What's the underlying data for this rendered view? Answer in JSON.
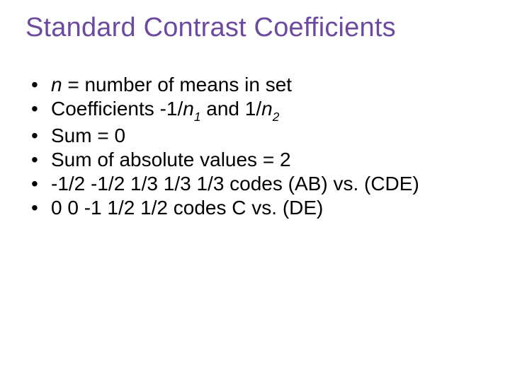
{
  "title": "Standard  Contrast Coefficients",
  "bullets": {
    "b1a": "n",
    "b1b": " = number of means in set",
    "b2a": "Coefficients -1/",
    "b2n1": "n",
    "b2s1": "1",
    "b2b": "  and 1/",
    "b2n2": "n",
    "b2s2": "2",
    "b3": "Sum = 0",
    "b4": "Sum of absolute values = 2",
    "b5": "-1/2 -1/2 1/3 1/3 1/3 codes (AB) vs. (CDE)",
    "b6": "0 0 -1 1/2 1/2 codes C vs. (DE)"
  }
}
